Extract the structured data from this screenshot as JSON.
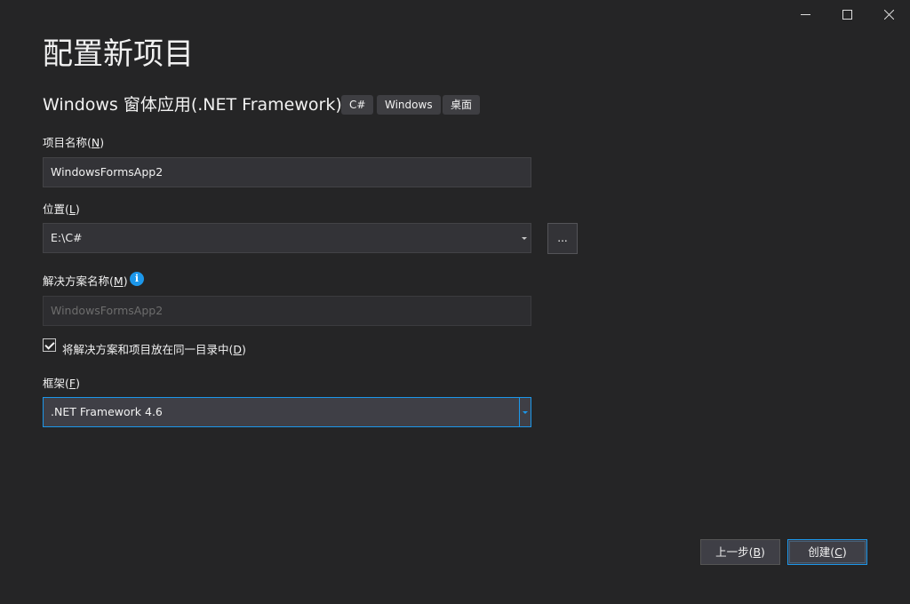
{
  "window": {
    "controls": [
      "minimize-icon",
      "maximize-icon",
      "close-icon"
    ]
  },
  "page": {
    "title": "配置新项目",
    "template_name": "Windows 窗体应用(.NET Framework)",
    "tags": [
      "C#",
      "Windows",
      "桌面"
    ]
  },
  "form": {
    "project_name": {
      "label_prefix": "项目名称(",
      "label_key": "N",
      "label_suffix": ")",
      "value": "WindowsFormsApp2"
    },
    "location": {
      "label_prefix": "位置(",
      "label_key": "L",
      "label_suffix": ")",
      "value": "E:\\C#",
      "browse_label": "..."
    },
    "solution_name": {
      "label_prefix": "解决方案名称(",
      "label_key": "M",
      "label_suffix": ")",
      "info_icon": "i",
      "placeholder": "WindowsFormsApp2"
    },
    "same_dir": {
      "checked": true,
      "label_prefix": "将解决方案和项目放在同一目录中(",
      "label_key": "D",
      "label_suffix": ")"
    },
    "framework": {
      "label_prefix": "框架(",
      "label_key": "F",
      "label_suffix": ")",
      "value": ".NET Framework 4.6"
    }
  },
  "footer": {
    "back": {
      "prefix": "上一步(",
      "key": "B",
      "suffix": ")"
    },
    "create": {
      "prefix": "创建(",
      "key": "C",
      "suffix": ")"
    }
  },
  "colors": {
    "background": "#252526",
    "accent": "#1c97ea",
    "field_bg": "#333337",
    "text": "#f1f1f1"
  }
}
